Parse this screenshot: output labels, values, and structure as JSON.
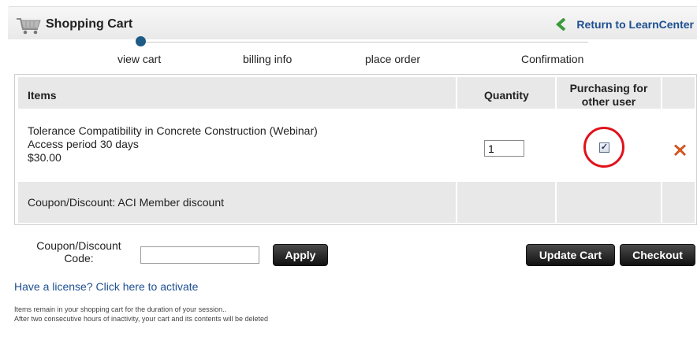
{
  "header": {
    "title": "Shopping Cart",
    "return_label": "Return to LearnCenter"
  },
  "steps": [
    {
      "label": "view cart",
      "active": true
    },
    {
      "label": "billing info",
      "active": false
    },
    {
      "label": "place order",
      "active": false
    },
    {
      "label": "Confirmation",
      "active": false
    }
  ],
  "table": {
    "headers": {
      "items": "Items",
      "quantity": "Quantity",
      "purchasing_line1": "Purchasing for",
      "purchasing_line2": "other user"
    },
    "item": {
      "name": "Tolerance Compatibility in Concrete Construction (Webinar)",
      "access": "Access period 30 days",
      "price": "$30.00",
      "quantity": "1",
      "purchasing_for_other_user": true
    },
    "coupon_row": "Coupon/Discount: ACI Member discount"
  },
  "coupon": {
    "label_line1": "Coupon/Discount",
    "label_line2": "Code:",
    "value": "",
    "apply_label": "Apply"
  },
  "actions": {
    "update_label": "Update Cart",
    "checkout_label": "Checkout"
  },
  "license_link": "Have a license? Click here to activate",
  "notes": [
    "Items remain in your shopping cart for the duration of your session..",
    "After two consecutive hours of inactivity, your cart and its contents will be deleted"
  ],
  "colors": {
    "link": "#1d4f91",
    "step_dot": "#1d5b86",
    "highlight_circle": "#e0121b",
    "delete_icon": "#e25a1c",
    "return_chevron": "#3a9a3a"
  },
  "icons": {
    "cart": "shopping-cart-icon",
    "return": "chevron-left-icon",
    "delete": "delete-x-icon"
  }
}
